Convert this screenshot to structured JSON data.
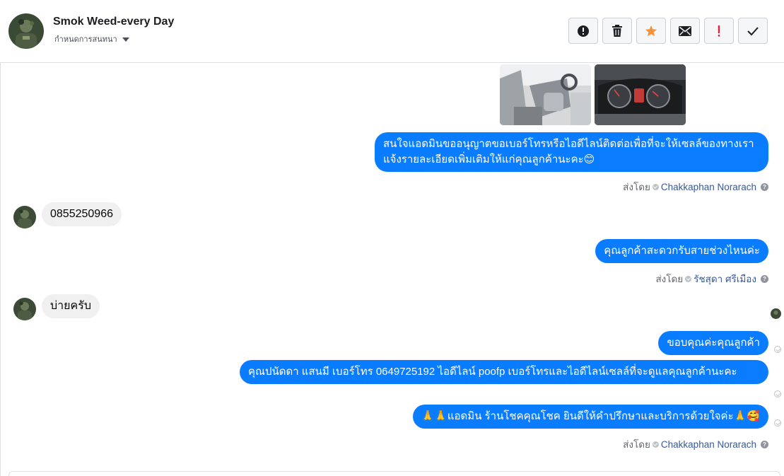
{
  "header": {
    "contact_name": "Smok Weed-every Day",
    "assign_label": "กำหนดการสนทนา",
    "actions": [
      {
        "icon": "alert-circle-icon",
        "label": "spam"
      },
      {
        "icon": "trash-icon",
        "label": "delete"
      },
      {
        "icon": "star-icon",
        "label": "star"
      },
      {
        "icon": "envelope-icon",
        "label": "mark-unread"
      },
      {
        "icon": "exclamation-icon",
        "label": "follow-up"
      },
      {
        "icon": "checkmark-icon",
        "label": "done"
      }
    ]
  },
  "colors": {
    "outgoing_bubble": "#0a7cff",
    "incoming_bubble": "#f0f0f0",
    "star": "#f5923e",
    "exclamation": "#e41e3f",
    "sender_link": "#385898"
  },
  "thread": {
    "images": [
      "car-interior-photo",
      "car-dashboard-photo"
    ],
    "out_1": "สนใจแอดมินขออนุญาตขอเบอร์โทรหรือไอดีไลน์ติดต่อเพื่อที่จะให้เซลล์ของทางเราแจ้งรายละเอียดเพิ่มเติมให้แก่คุณลูกค้านะคะ😊",
    "sent_by_label": "ส่งโดย",
    "sender_1": "Chakkaphan Norarach",
    "in_1": "0855250966",
    "out_2": "คุณลูกค้าสะดวกรับสายช่วงไหนค่ะ",
    "sender_2": "รัชสุดา ศรีเมือง",
    "in_2": "บ่ายครับ",
    "out_3": "ขอบคุณค่ะคุณลูกค้า",
    "out_4": "คุณปนัดดา แสนมี   เบอร์โทร 0649725192  ไอดีไลน์ poofp   เบอร์โทรและไอดีไลน์เซลล์ที่จะดูแลคุณลูกค้านะคะ",
    "out_5": "🙏🙏แอดมิน ร้านโชคคุณโชค ยินดีให้คำปรึกษาและบริการด้วยใจค่ะ🙏🥰",
    "sender_3": "Chakkaphan Norarach"
  }
}
